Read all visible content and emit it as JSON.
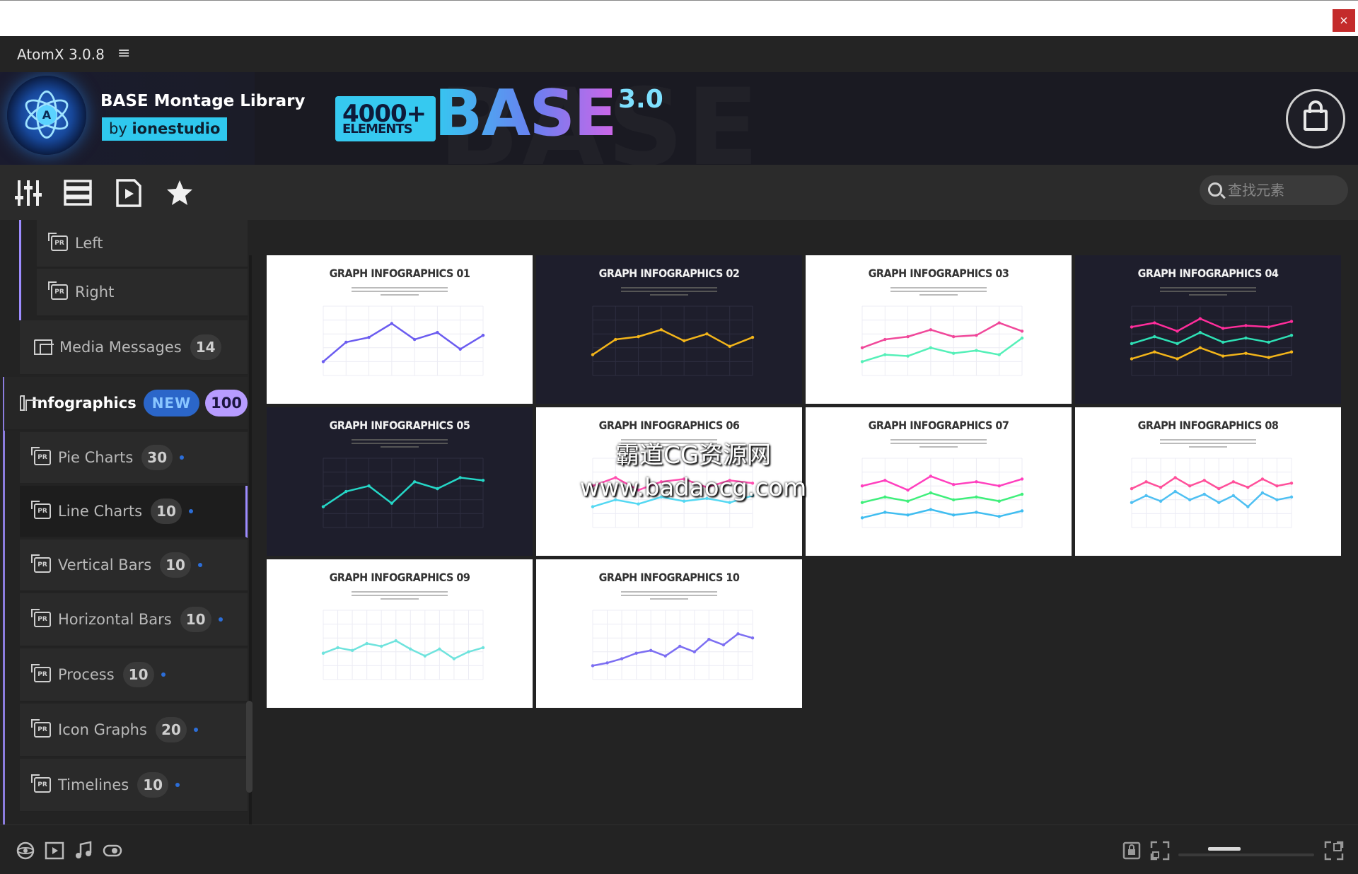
{
  "window": {
    "close_glyph": "×"
  },
  "app": {
    "title": "AtomX 3.0.8",
    "menu_glyph": "≡"
  },
  "banner": {
    "library_title": "BASE Montage Library",
    "by_prefix": "by ",
    "by_author": "ionestudio",
    "promo_count": "4000+",
    "promo_unit": "ELEMENTS",
    "promo_word": "BASE",
    "promo_version": "3.0",
    "bg_word": "BASE"
  },
  "toolbar": {
    "icons": [
      "sliders-icon",
      "list-icon",
      "play-file-icon",
      "star-icon"
    ],
    "search_placeholder": "查找元素"
  },
  "sidebar": {
    "items": [
      {
        "label": "Left",
        "kind": "pr"
      },
      {
        "label": "Right",
        "kind": "pr"
      },
      {
        "label": "Media Messages",
        "count": "14",
        "kind": "folder"
      },
      {
        "label": "Infographics",
        "badge": "NEW",
        "count": "100",
        "kind": "folder"
      },
      {
        "label": "Pie Charts",
        "count": "30",
        "kind": "pr"
      },
      {
        "label": "Line Charts",
        "count": "10",
        "kind": "pr",
        "active": true
      },
      {
        "label": "Vertical Bars",
        "count": "10",
        "kind": "pr"
      },
      {
        "label": "Horizontal Bars",
        "count": "10",
        "kind": "pr"
      },
      {
        "label": "Process",
        "count": "10",
        "kind": "pr"
      },
      {
        "label": "Icon Graphs",
        "count": "20",
        "kind": "pr"
      },
      {
        "label": "Timelines",
        "count": "10",
        "kind": "pr"
      }
    ]
  },
  "cards": [
    {
      "title": "GRAPH INFOGRAPHICS 01",
      "theme": "light",
      "lines": [
        {
          "color": "#6b5cf0",
          "values": [
            20,
            48,
            55,
            75,
            52,
            62,
            38,
            58
          ]
        }
      ]
    },
    {
      "title": "GRAPH INFOGRAPHICS 02",
      "theme": "dark",
      "lines": [
        {
          "color": "#f3b51a",
          "values": [
            30,
            52,
            56,
            66,
            50,
            60,
            42,
            55
          ]
        }
      ]
    },
    {
      "title": "GRAPH INFOGRAPHICS 03",
      "theme": "light",
      "lines": [
        {
          "color": "#f0489a",
          "values": [
            40,
            52,
            56,
            66,
            56,
            58,
            76,
            64
          ]
        },
        {
          "color": "#55f0b8",
          "values": [
            20,
            30,
            28,
            40,
            32,
            36,
            30,
            54
          ]
        }
      ]
    },
    {
      "title": "GRAPH INFOGRAPHICS 04",
      "theme": "dark",
      "lines": [
        {
          "color": "#ff2d9b",
          "values": [
            70,
            76,
            64,
            82,
            68,
            72,
            70,
            78
          ]
        },
        {
          "color": "#2ee0b5",
          "values": [
            46,
            56,
            46,
            62,
            48,
            54,
            48,
            58
          ]
        },
        {
          "color": "#f3b51a",
          "values": [
            24,
            34,
            24,
            40,
            28,
            32,
            26,
            34
          ]
        }
      ]
    },
    {
      "title": "GRAPH INFOGRAPHICS 05",
      "theme": "dark",
      "lines": [
        {
          "color": "#25d7c7",
          "values": [
            30,
            52,
            60,
            35,
            66,
            56,
            72,
            68
          ]
        }
      ]
    },
    {
      "title": "GRAPH INFOGRAPHICS 06",
      "theme": "light",
      "lines": [
        {
          "color": "#ff4fb0",
          "values": [
            60,
            72,
            54,
            66,
            70,
            58,
            68,
            64
          ]
        },
        {
          "color": "#54d8f2",
          "values": [
            30,
            40,
            34,
            44,
            38,
            42,
            36,
            46
          ]
        }
      ]
    },
    {
      "title": "GRAPH INFOGRAPHICS 07",
      "theme": "light",
      "lines": [
        {
          "color": "#ff3fbe",
          "values": [
            60,
            68,
            54,
            74,
            62,
            66,
            60,
            70
          ]
        },
        {
          "color": "#3fef7b",
          "values": [
            36,
            44,
            38,
            50,
            40,
            44,
            38,
            48
          ]
        },
        {
          "color": "#3fbdf0",
          "values": [
            14,
            22,
            18,
            26,
            18,
            22,
            16,
            24
          ]
        }
      ]
    },
    {
      "title": "GRAPH INFOGRAPHICS 08",
      "theme": "light",
      "lines": [
        {
          "color": "#ff4f9a",
          "values": [
            56,
            66,
            58,
            72,
            60,
            68,
            56,
            66,
            58,
            70,
            60,
            64
          ]
        },
        {
          "color": "#4fc0f2",
          "values": [
            36,
            46,
            38,
            52,
            40,
            48,
            36,
            46,
            30,
            50,
            40,
            44
          ]
        }
      ]
    },
    {
      "title": "GRAPH INFOGRAPHICS 09",
      "theme": "light",
      "lines": [
        {
          "color": "#6fe3dd",
          "values": [
            38,
            46,
            42,
            52,
            48,
            56,
            44,
            34,
            44,
            30,
            40,
            46
          ]
        }
      ]
    },
    {
      "title": "GRAPH INFOGRAPHICS 10",
      "theme": "light",
      "lines": [
        {
          "color": "#7c6ef2",
          "values": [
            20,
            24,
            30,
            38,
            42,
            34,
            48,
            40,
            58,
            50,
            66,
            60
          ]
        }
      ]
    }
  ],
  "watermark": {
    "line1": "霸道CG资源网",
    "line2": "www.badaocg.com"
  },
  "bottom_bar": {
    "icons": [
      "3d-cube-icon",
      "video-icon",
      "music-icon",
      "toggle-icon"
    ],
    "right_icons": [
      "lock-icon",
      "fit-icon",
      "expand-icon"
    ],
    "zoom_level": 0.34
  }
}
